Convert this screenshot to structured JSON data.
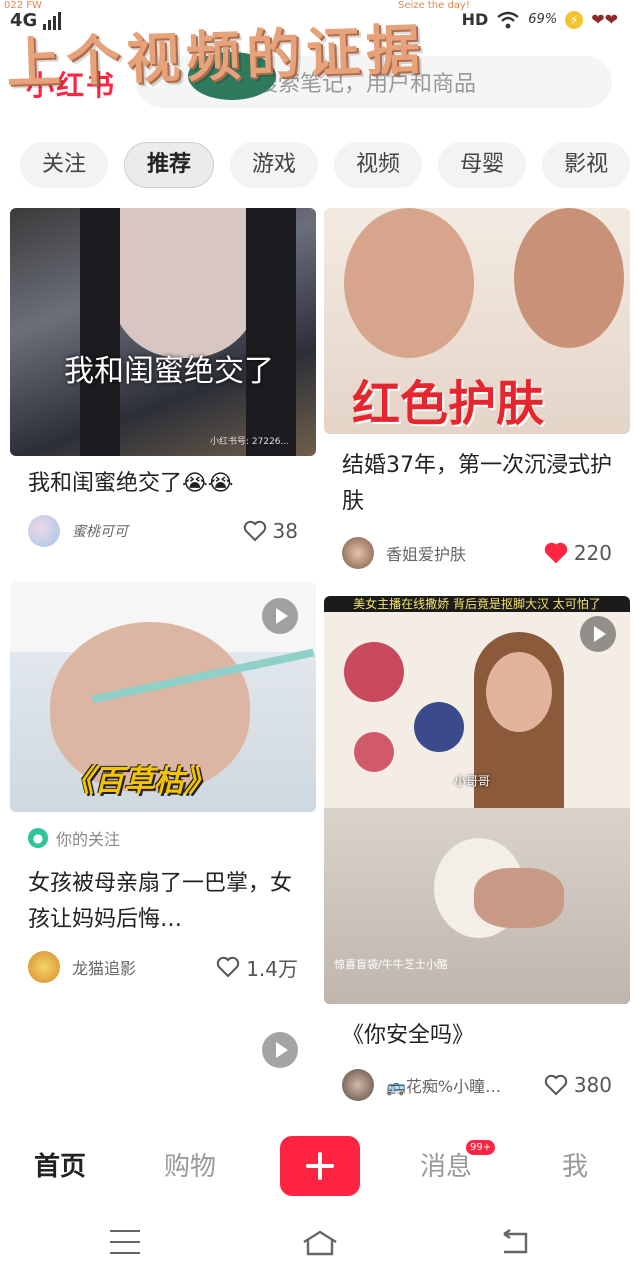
{
  "status": {
    "tiny_left": "022 FW",
    "tiny_right": "Seize the day!",
    "signal": "4G",
    "hd": "HD",
    "battery": "69%"
  },
  "overlay": {
    "caption": "上个视频的证据"
  },
  "header": {
    "logo": "小红书",
    "search_placeholder": "搜索笔记，用户和商品"
  },
  "tabs": [
    {
      "label": "关注",
      "active": false
    },
    {
      "label": "推荐",
      "active": true
    },
    {
      "label": "游戏",
      "active": false
    },
    {
      "label": "视频",
      "active": false
    },
    {
      "label": "母婴",
      "active": false
    },
    {
      "label": "影视",
      "active": false
    }
  ],
  "feed": {
    "left": [
      {
        "overlay_text": "我和闺蜜绝交了",
        "title": "我和闺蜜绝交了😭😭",
        "author": "蜜桃可可",
        "likes": "38",
        "liked": false,
        "watermark": "小红书号: 27226..."
      },
      {
        "overlay_text": "《百草枯》",
        "follow_tag": "你的关注",
        "title": "女孩被母亲扇了一巴掌，女孩让妈妈后悔…",
        "author": "龙猫追影",
        "likes": "1.4万",
        "liked": false
      }
    ],
    "right": [
      {
        "overlay_text": "红色护肤",
        "title": "结婚37年，第一次沉浸式护肤",
        "author": "香姐爱护肤",
        "likes": "220",
        "liked": true
      },
      {
        "banner": "美女主播在线撒娇 背后竟是抠脚大汉 太可怕了",
        "name_tag": "小哥哥",
        "caption": "惊喜盲袋/牛牛芝士小酪",
        "title": "《你安全吗》",
        "author": "🚌花痴%小瞳…",
        "likes": "380",
        "liked": false
      }
    ]
  },
  "bottom_nav": {
    "home": "首页",
    "shop": "购物",
    "messages": "消息",
    "badge": "99+",
    "me": "我"
  },
  "colors": {
    "brand": "#ff2442"
  }
}
